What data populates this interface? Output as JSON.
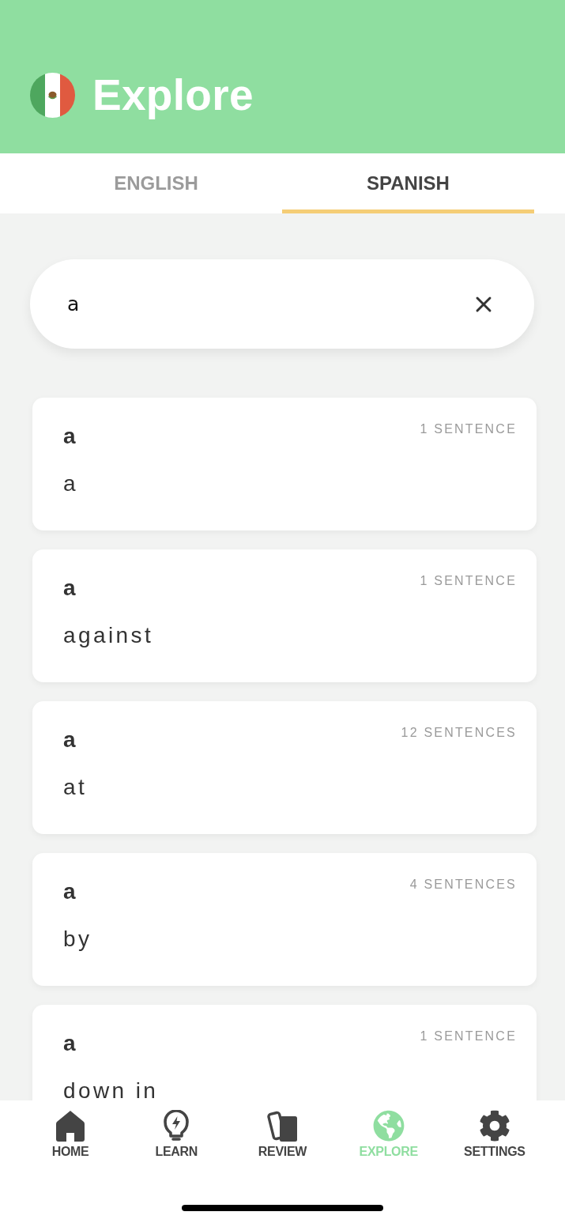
{
  "header": {
    "title": "Explore"
  },
  "tabs": [
    {
      "label": "ENGLISH",
      "selected": false
    },
    {
      "label": "SPANISH",
      "selected": true
    }
  ],
  "search": {
    "value": "a"
  },
  "results": [
    {
      "word": "a",
      "translation": "a",
      "count": "1 SENTENCE"
    },
    {
      "word": "a",
      "translation": "against",
      "count": "1 SENTENCE"
    },
    {
      "word": "a",
      "translation": "at",
      "count": "12 SENTENCES"
    },
    {
      "word": "a",
      "translation": "by",
      "count": "4 SENTENCES"
    },
    {
      "word": "a",
      "translation": "down in",
      "count": "1 SENTENCE"
    }
  ],
  "nav": [
    {
      "kind": "home",
      "label": "HOME",
      "selected": false
    },
    {
      "kind": "learn",
      "label": "LEARN",
      "selected": false
    },
    {
      "kind": "review",
      "label": "REVIEW",
      "selected": false
    },
    {
      "kind": "explore",
      "label": "EXPLORE",
      "selected": true
    },
    {
      "kind": "settings",
      "label": "SETTINGS",
      "selected": false
    }
  ]
}
